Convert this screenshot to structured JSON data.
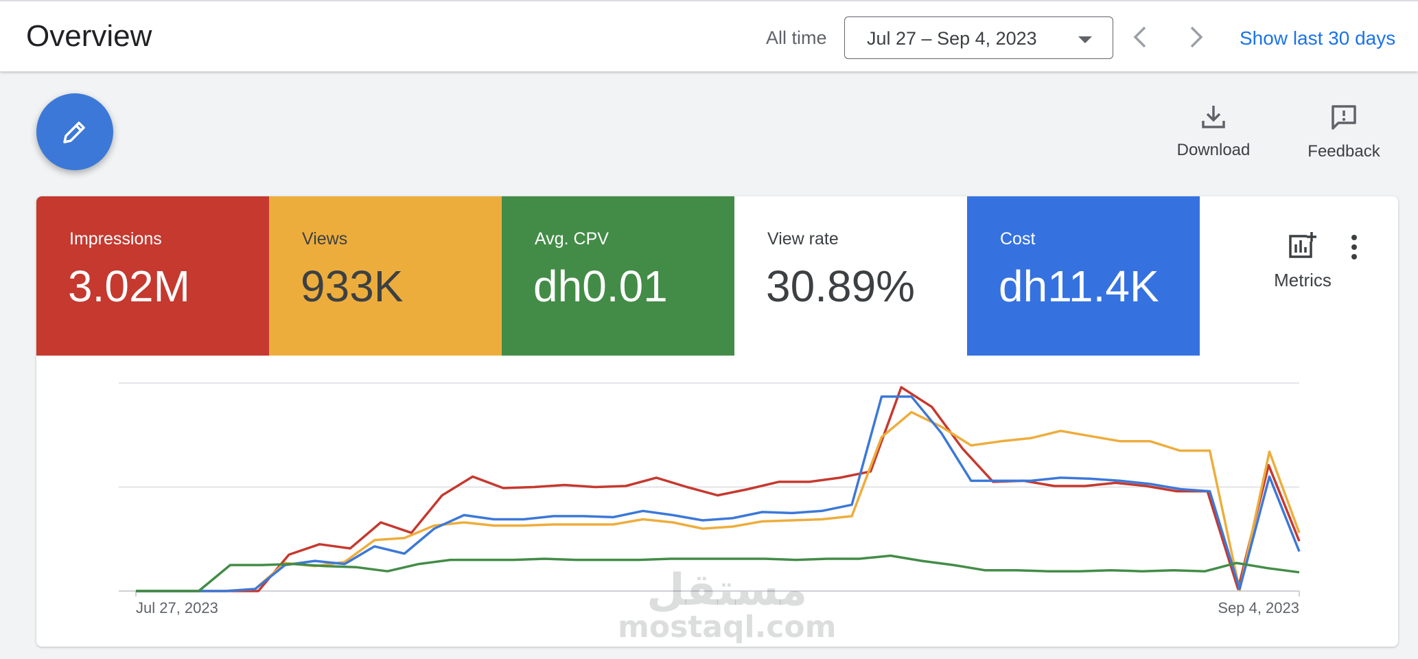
{
  "header": {
    "title": "Overview",
    "range_label": "All time",
    "date_range": "Jul 27 – Sep 4, 2023",
    "show_last": "Show last 30 days"
  },
  "actions": {
    "download": "Download",
    "feedback": "Feedback"
  },
  "metrics": [
    {
      "label": "Impressions",
      "value": "3.02M",
      "bg": "#c5392f",
      "fg": "#ffffff"
    },
    {
      "label": "Views",
      "value": "933K",
      "bg": "#edad3c",
      "fg": "#3c4043"
    },
    {
      "label": "Avg. CPV",
      "value": "dh0.01",
      "bg": "#438c47",
      "fg": "#ffffff"
    },
    {
      "label": "View rate",
      "value": "30.89%",
      "bg": "#ffffff",
      "fg": "#3c4043"
    },
    {
      "label": "Cost",
      "value": "dh11.4K",
      "bg": "#3572e0",
      "fg": "#ffffff"
    }
  ],
  "metrics_button": "Metrics",
  "watermark": {
    "arabic": "مستقل",
    "latin": "mostaql.com"
  },
  "chart_data": {
    "type": "line",
    "x_start": "Jul 27, 2023",
    "x_end": "Sep 4, 2023",
    "ylim": [
      0,
      2
    ],
    "grid": true,
    "series": [
      {
        "color": "#c5392f",
        "values": [
          0,
          0,
          0,
          0,
          0,
          0.35,
          0.45,
          0.41,
          0.66,
          0.56,
          0.92,
          1.1,
          0.99,
          1.0,
          1.02,
          1.0,
          1.01,
          1.09,
          1.0,
          0.92,
          0.98,
          1.05,
          1.05,
          1.09,
          1.15,
          1.96,
          1.77,
          1.37,
          1.05,
          1.06,
          1.01,
          1.01,
          1.04,
          1.01,
          0.96,
          0.96,
          0.02,
          1.21,
          0.48
        ]
      },
      {
        "color": "#edad3c",
        "values": [
          0,
          0,
          0,
          0,
          0.02,
          0.27,
          0.24,
          0.28,
          0.49,
          0.51,
          0.63,
          0.66,
          0.63,
          0.63,
          0.64,
          0.64,
          0.64,
          0.69,
          0.66,
          0.6,
          0.62,
          0.67,
          0.68,
          0.69,
          0.72,
          1.48,
          1.72,
          1.58,
          1.4,
          1.44,
          1.47,
          1.54,
          1.49,
          1.44,
          1.44,
          1.35,
          1.35,
          0.01,
          1.34,
          0.56
        ]
      },
      {
        "color": "#3c78d8",
        "values": [
          0,
          0,
          0,
          0,
          0.02,
          0.25,
          0.29,
          0.26,
          0.43,
          0.36,
          0.6,
          0.73,
          0.69,
          0.69,
          0.72,
          0.72,
          0.71,
          0.77,
          0.73,
          0.68,
          0.7,
          0.76,
          0.75,
          0.77,
          0.83,
          1.87,
          1.87,
          1.52,
          1.06,
          1.06,
          1.06,
          1.09,
          1.08,
          1.06,
          1.03,
          0.98,
          0.96,
          0.02,
          1.1,
          0.38
        ]
      },
      {
        "color": "#438c47",
        "values": [
          0,
          0,
          0,
          0.25,
          0.25,
          0.26,
          0.24,
          0.23,
          0.19,
          0.26,
          0.3,
          0.3,
          0.3,
          0.31,
          0.3,
          0.3,
          0.3,
          0.31,
          0.31,
          0.31,
          0.31,
          0.3,
          0.31,
          0.31,
          0.34,
          0.29,
          0.25,
          0.2,
          0.2,
          0.19,
          0.19,
          0.2,
          0.19,
          0.2,
          0.19,
          0.27,
          0.22,
          0.18
        ]
      }
    ]
  }
}
